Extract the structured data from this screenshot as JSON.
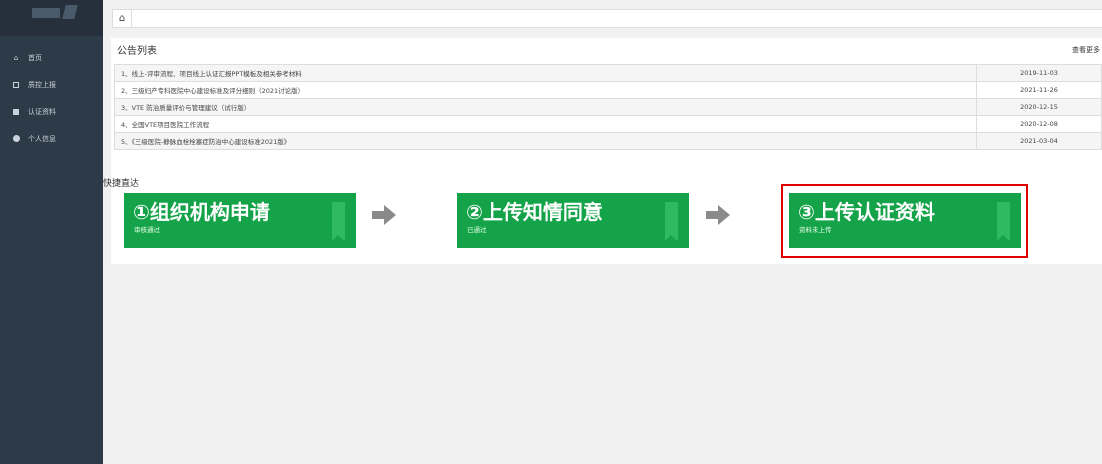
{
  "sidebar": {
    "items": [
      {
        "icon": "home-icon",
        "label": "首页"
      },
      {
        "icon": "grid-icon",
        "label": "质控上报"
      },
      {
        "icon": "checkbox-icon",
        "label": "认证资料"
      },
      {
        "icon": "user-circle-icon",
        "label": "个人信息"
      }
    ]
  },
  "topbar": {
    "home_tab_icon": "home-icon",
    "home_tab_glyph": "⌂"
  },
  "notices": {
    "title": "公告列表",
    "more_label": "查看更多",
    "rows": [
      {
        "title": "1、线上-评审流程、项目线上认证汇报PPT模板及相关参考材料",
        "date": "2019-11-03"
      },
      {
        "title": "2、三级妇产专科医院中心建设标准及评分细则（2021讨论版）",
        "date": "2021-11-26"
      },
      {
        "title": "3、VTE 防治质量评价与管理建议（试行版）",
        "date": "2020-12-15"
      },
      {
        "title": "4、全国VTE项目医院工作流程",
        "date": "2020-12-08"
      },
      {
        "title": "5、《三级医院-静脉血栓栓塞症防治中心建设标准2021版》",
        "date": "2021-03-04"
      }
    ]
  },
  "quick": {
    "title": "快捷直达",
    "cards": [
      {
        "title": "①组织机构申请",
        "status": "审核通过"
      },
      {
        "title": "②上传知情同意",
        "status": "已通过"
      },
      {
        "title": "③上传认证资料",
        "status": "资料未上传"
      }
    ]
  },
  "colors": {
    "sidebar_bg": "#2d3a48",
    "card_green": "#15a34a",
    "highlight_red": "#e00000",
    "arrow_gray": "#8a8a8a"
  }
}
